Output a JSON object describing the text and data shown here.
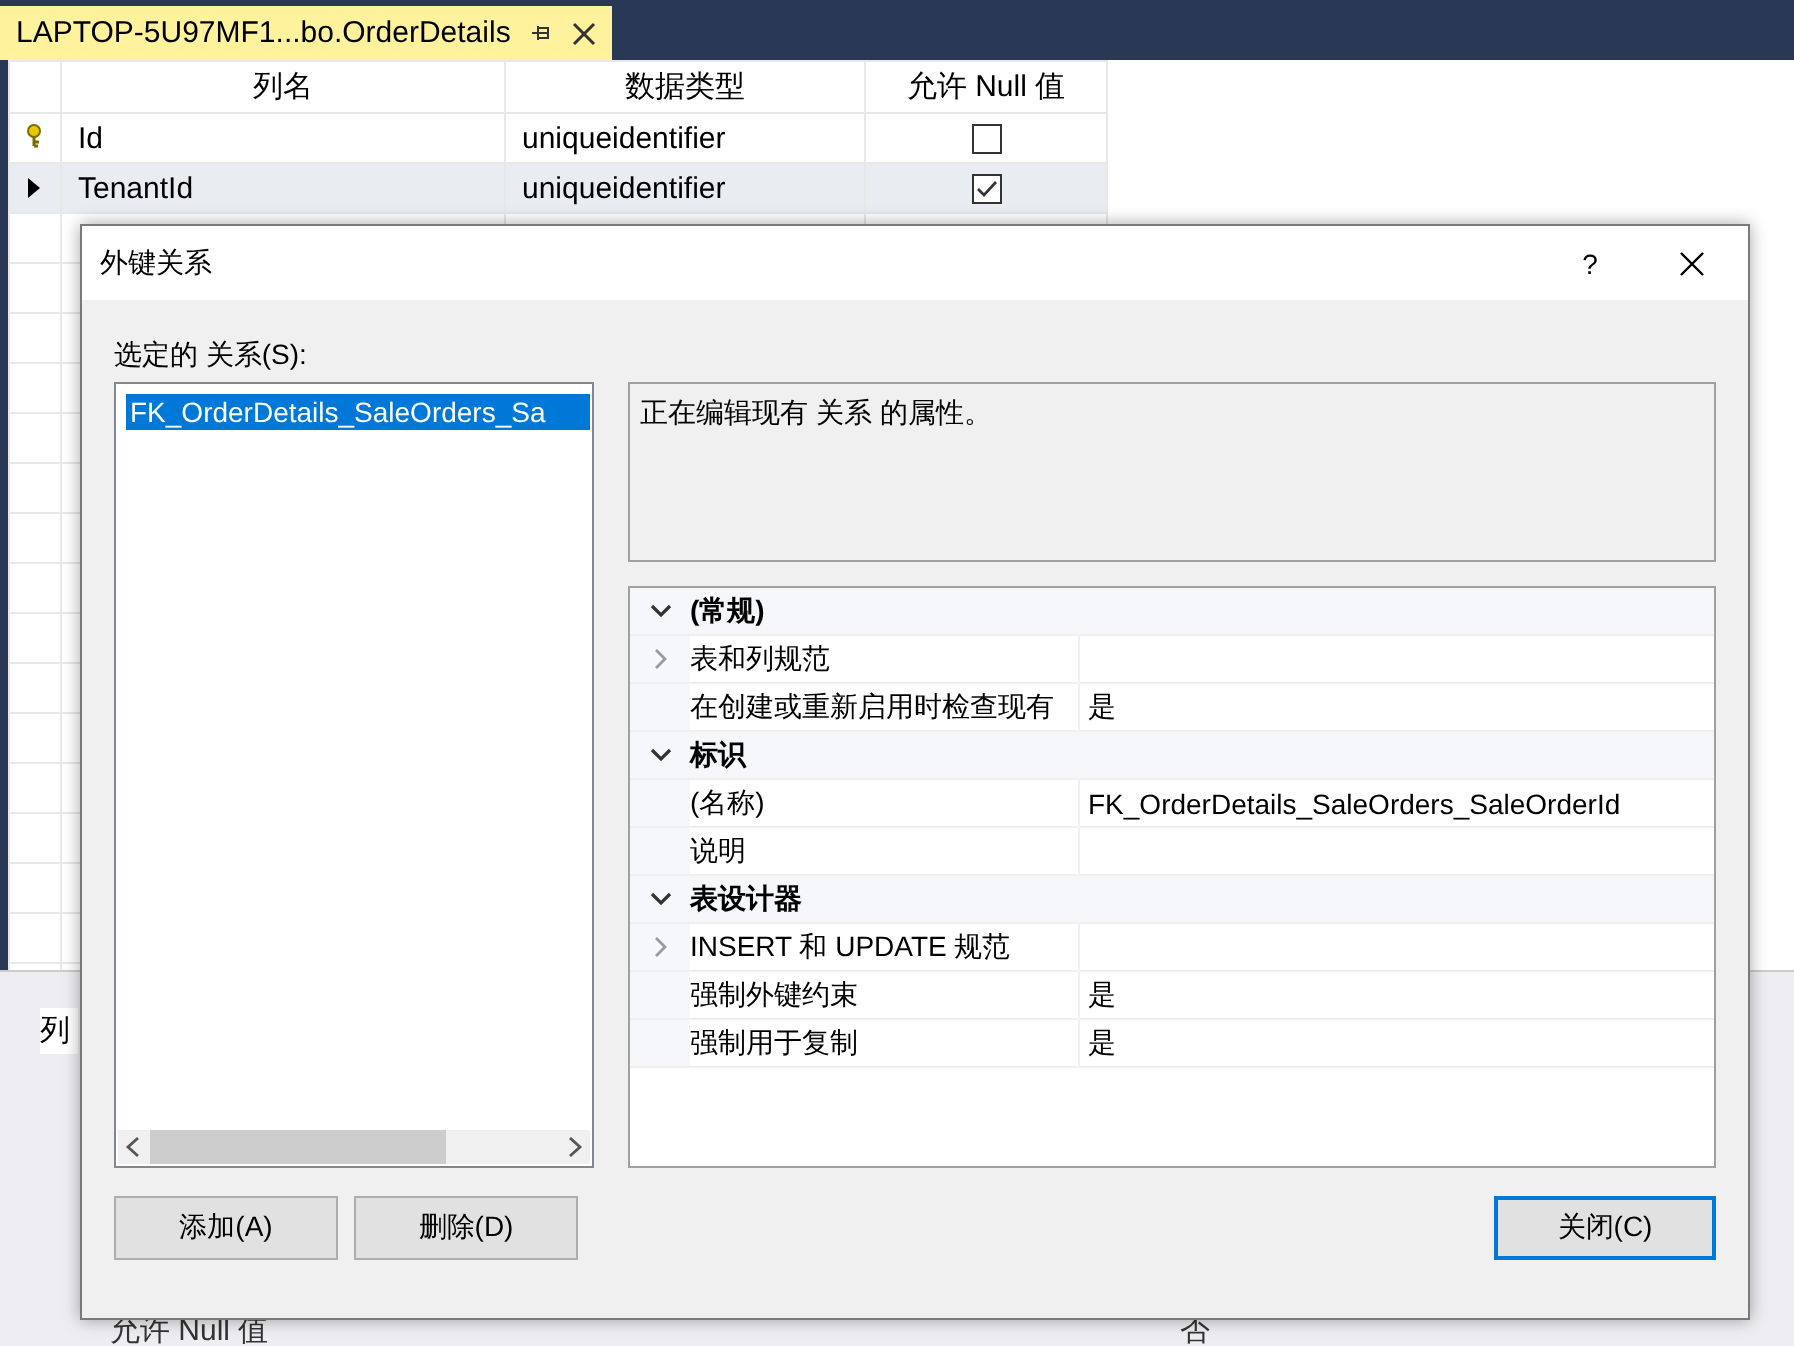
{
  "editor_tab": {
    "title": "LAPTOP-5U97MF1...bo.OrderDetails"
  },
  "table": {
    "columns": [
      "列名",
      "数据类型",
      "允许 Null 值"
    ],
    "rows": [
      {
        "name": "Id",
        "type": "uniqueidentifier",
        "allow_null": false,
        "primary_key": true,
        "selected": false
      },
      {
        "name": "TenantId",
        "type": "uniqueidentifier",
        "allow_null": true,
        "primary_key": false,
        "selected": true
      }
    ]
  },
  "properties_pane": {
    "tab": "列",
    "row": {
      "name": "允许 Null 值",
      "value": "否"
    }
  },
  "dialog": {
    "title": "外键关系",
    "help": "?",
    "list_label": "选定的 关系(S):",
    "relationships": [
      {
        "name": "FK_OrderDetails_SaleOrders_Sa",
        "selected": true
      }
    ],
    "description": "正在编辑现有 关系 的属性。",
    "categories": [
      {
        "label": "(常规)",
        "expanded": true,
        "children": [
          {
            "label": "表和列规范",
            "collapsed": true
          },
          {
            "label": "在创建或重新启用时检查现有",
            "value": "是",
            "collapsed": false
          }
        ]
      },
      {
        "label": "标识",
        "expanded": true,
        "children": [
          {
            "label": "(名称)",
            "value": "FK_OrderDetails_SaleOrders_SaleOrderId",
            "collapsed": false
          },
          {
            "label": "说明",
            "collapsed": false
          }
        ]
      },
      {
        "label": "表设计器",
        "expanded": true,
        "children": [
          {
            "label": "INSERT 和 UPDATE 规范",
            "collapsed": true
          },
          {
            "label": "强制外键约束",
            "value": "是",
            "collapsed": false
          },
          {
            "label": "强制用于复制",
            "value": "是",
            "collapsed": false
          }
        ]
      }
    ],
    "buttons": [
      {
        "label": "添加(A)"
      },
      {
        "label": "删除(D)"
      }
    ],
    "close_button": {
      "label": "关闭(C)",
      "focused": true
    }
  }
}
